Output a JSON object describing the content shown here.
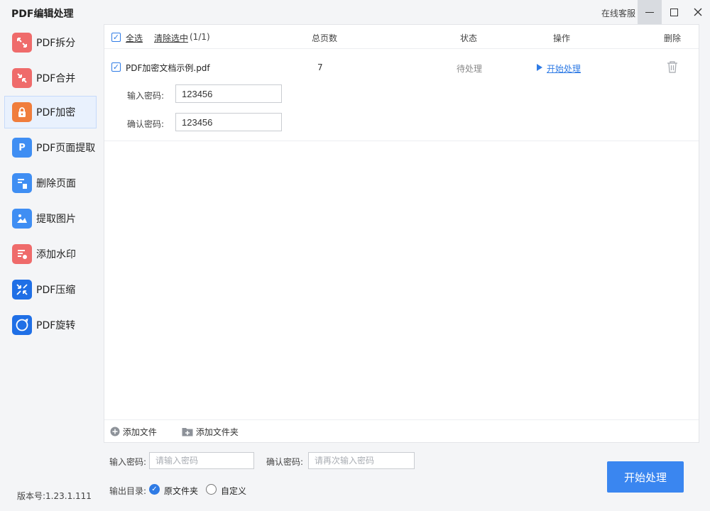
{
  "window": {
    "title": "PDF编辑处理",
    "service_label": "在线客服",
    "minimize_icon": "minimize-icon",
    "maximize_icon": "maximize-icon",
    "close_icon": "close-icon"
  },
  "sidebar": {
    "items": [
      {
        "label": "PDF拆分",
        "icon": "split-icon",
        "color": "#ef6b6b"
      },
      {
        "label": "PDF合并",
        "icon": "merge-icon",
        "color": "#ef6b6b"
      },
      {
        "label": "PDF加密",
        "icon": "lock-icon",
        "color": "#f07d3c",
        "active": true
      },
      {
        "label": "PDF页面提取",
        "icon": "page-extract-icon",
        "color": "#3f8ef3"
      },
      {
        "label": "删除页面",
        "icon": "delete-page-icon",
        "color": "#3f8ef3"
      },
      {
        "label": "提取图片",
        "icon": "image-extract-icon",
        "color": "#3f8ef3"
      },
      {
        "label": "添加水印",
        "icon": "watermark-icon",
        "color": "#ef6b6b"
      },
      {
        "label": "PDF压缩",
        "icon": "compress-icon",
        "color": "#1f6fe6"
      },
      {
        "label": "PDF旋转",
        "icon": "rotate-icon",
        "color": "#1f6fe6"
      }
    ],
    "version": "版本号:1.23.1.111"
  },
  "table": {
    "select_all": "全选",
    "clear_selection": "清除选中",
    "selection_count": "(1/1)",
    "columns": {
      "pages": "总页数",
      "status": "状态",
      "action": "操作",
      "delete": "删除"
    },
    "rows": [
      {
        "file_name": "PDF加密文档示例.pdf",
        "pages": "7",
        "status": "待处理",
        "action": "开始处理",
        "password_label": "输入密码:",
        "password_value": "123456",
        "confirm_label": "确认密码:",
        "confirm_value": "123456"
      }
    ]
  },
  "panel_footer": {
    "add_file": "添加文件",
    "add_folder": "添加文件夹"
  },
  "bottom": {
    "password_label": "输入密码:",
    "password_placeholder": "请输入密码",
    "confirm_label": "确认密码:",
    "confirm_placeholder": "请再次输入密码",
    "output_label": "输出目录:",
    "option_original": "原文件夹",
    "option_custom": "自定义",
    "start_button": "开始处理"
  },
  "colors": {
    "accent": "#3a86f0",
    "link": "#2f7be5"
  }
}
